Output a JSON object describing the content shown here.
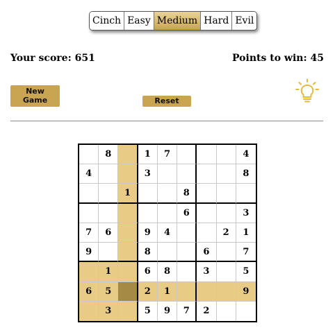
{
  "difficulty": {
    "options": [
      "Cinch",
      "Easy",
      "Medium",
      "Hard",
      "Evil"
    ],
    "selected": "Medium"
  },
  "score": {
    "your_score_label": "Your score: 651",
    "points_to_win_label": "Points to win: 45"
  },
  "buttons": {
    "new_game_label_line1": "New",
    "new_game_label_line2": "Game",
    "reset_label": "Reset"
  },
  "hint": {
    "icon": "lightbulb-icon",
    "color": "#e8b93a"
  },
  "colors": {
    "accent": "#c9a451",
    "highlight": "#e8cc85",
    "selected": "#a58a45"
  },
  "board": {
    "selected_cell": [
      7,
      2
    ],
    "rows": [
      [
        "",
        "8",
        "",
        "1",
        "7",
        "",
        "",
        "",
        "4"
      ],
      [
        "4",
        "",
        "",
        "3",
        "",
        "",
        "",
        "",
        "8"
      ],
      [
        "",
        "",
        "1",
        "",
        "",
        "8",
        "",
        "",
        ""
      ],
      [
        "",
        "",
        "",
        "",
        "",
        "6",
        "",
        "",
        "3"
      ],
      [
        "7",
        "6",
        "",
        "9",
        "4",
        "",
        "",
        "2",
        "1"
      ],
      [
        "9",
        "",
        "",
        "8",
        "",
        "",
        "6",
        "",
        "7"
      ],
      [
        "",
        "1",
        "",
        "6",
        "8",
        "",
        "3",
        "",
        "5"
      ],
      [
        "6",
        "5",
        "",
        "2",
        "1",
        "",
        "",
        "",
        "9"
      ],
      [
        "",
        "3",
        "",
        "5",
        "9",
        "7",
        "2",
        "",
        ""
      ]
    ]
  }
}
